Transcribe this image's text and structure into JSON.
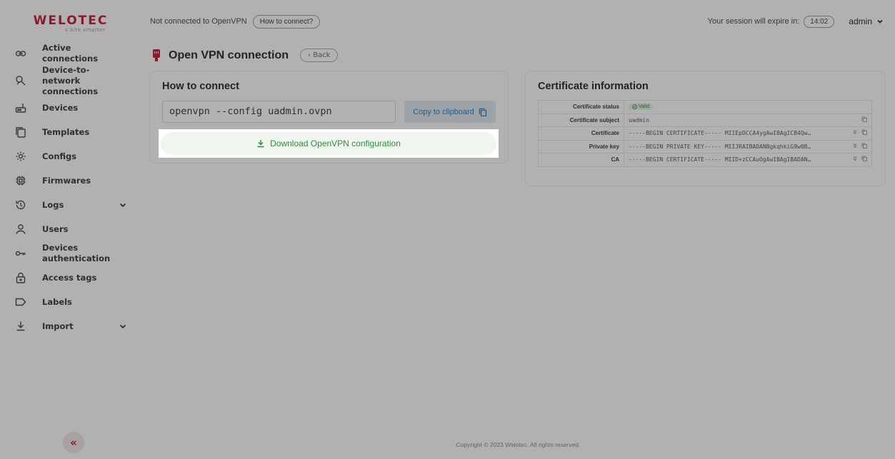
{
  "brand": {
    "logo_text": "WELOTEC",
    "tagline": "a bite smarter",
    "accent_color": "#c8102e"
  },
  "sidebar": {
    "items": [
      {
        "label": "Active connections",
        "icon": "link-icon"
      },
      {
        "label": "Device-to-network connections",
        "icon": "network-icon"
      },
      {
        "label": "Devices",
        "icon": "router-icon"
      },
      {
        "label": "Templates",
        "icon": "copy-icon"
      },
      {
        "label": "Configs",
        "icon": "gear-icon"
      },
      {
        "label": "Firmwares",
        "icon": "chip-icon"
      },
      {
        "label": "Logs",
        "icon": "history-icon",
        "expandable": true
      },
      {
        "label": "Users",
        "icon": "user-icon"
      },
      {
        "label": "Devices authentication",
        "icon": "key-icon"
      },
      {
        "label": "Access tags",
        "icon": "lock-icon"
      },
      {
        "label": "Labels",
        "icon": "tag-icon"
      },
      {
        "label": "Import",
        "icon": "download-icon",
        "expandable": true
      }
    ],
    "collapse_label": "«"
  },
  "topbar": {
    "vpn_status": "Not connected to OpenVPN",
    "how_to_connect": "How to connect?",
    "session_text": "Your session will expire in:",
    "session_timer": "14:02",
    "user": "admin"
  },
  "page": {
    "title": "Open VPN connection",
    "back_label": "‹ Back"
  },
  "connect_card": {
    "title": "How to connect",
    "command": "openvpn --config uadmin.ovpn",
    "copy_label": "Copy to clipboard",
    "download_label": "Download OpenVPN configuration"
  },
  "cert_card": {
    "title": "Certificate information",
    "rows": [
      {
        "key": "Certificate status",
        "value": "Valid"
      },
      {
        "key": "Certificate subject",
        "value": "uadmin"
      },
      {
        "key": "Certificate",
        "value": "-----BEGIN CERTIFICATE----- MIIEpDCCA4ygAwIBAgICB4Qw…"
      },
      {
        "key": "Private key",
        "value": "-----BEGIN PRIVATE KEY----- MIIJRAIBADANBgkqhkiG9w0B…"
      },
      {
        "key": "CA",
        "value": "-----BEGIN CERTIFICATE----- MIID+zCCAuOgAwIBAgIBADAN…"
      }
    ]
  },
  "footer": {
    "copyright": "Copyright © 2023 Welotec. All rights reserved."
  }
}
